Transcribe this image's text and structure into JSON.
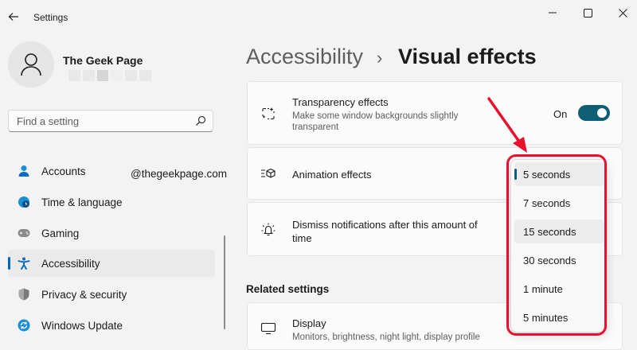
{
  "window": {
    "title": "Settings"
  },
  "profile": {
    "name": "The Geek Page"
  },
  "search": {
    "placeholder": "Find a setting"
  },
  "sidebar": {
    "items": [
      {
        "label": "Accounts",
        "icon": "person-icon"
      },
      {
        "label": "Time & language",
        "icon": "globe-clock-icon"
      },
      {
        "label": "Gaming",
        "icon": "gamepad-icon"
      },
      {
        "label": "Accessibility",
        "icon": "accessibility-icon",
        "active": true
      },
      {
        "label": "Privacy & security",
        "icon": "shield-icon"
      },
      {
        "label": "Windows Update",
        "icon": "update-icon"
      }
    ]
  },
  "watermark": "@thegeekpage.com",
  "header": {
    "parent": "Accessibility",
    "separator": "›",
    "current": "Visual effects"
  },
  "settings": {
    "transparency": {
      "title": "Transparency effects",
      "desc_line1": "Make some window backgrounds slightly",
      "desc_line2": "transparent",
      "state": "On"
    },
    "animation": {
      "title": "Animation effects"
    },
    "dismiss": {
      "title_line1": "Dismiss notifications after this amount of",
      "title_line2": "time"
    }
  },
  "related": {
    "title": "Related settings",
    "display": {
      "title": "Display",
      "desc": "Monitors, brightness, night light, display profile"
    }
  },
  "dropdown": {
    "options": [
      "5 seconds",
      "7 seconds",
      "15 seconds",
      "30 seconds",
      "1 minute",
      "5 minutes"
    ],
    "selected": "5 seconds"
  },
  "colors": {
    "accent": "#0e5f73",
    "highlight": "#e8112d",
    "active_indicator": "#0067c0"
  }
}
